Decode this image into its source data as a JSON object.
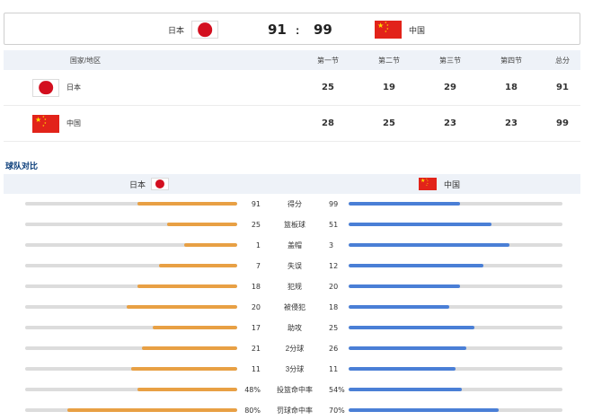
{
  "scoreboard": {
    "home": {
      "name": "日本",
      "score": "91"
    },
    "away": {
      "name": "中国",
      "score": "99"
    },
    "separator": ":"
  },
  "quarters": {
    "headers": [
      "国家/地区",
      "第一节",
      "第二节",
      "第三节",
      "第四节",
      "总分"
    ],
    "rows": [
      {
        "team": "日本",
        "flag": "japan-flag-icon",
        "q1": "25",
        "q2": "19",
        "q3": "29",
        "q4": "18",
        "total": "91"
      },
      {
        "team": "中国",
        "flag": "china-flag-icon",
        "q1": "28",
        "q2": "25",
        "q3": "23",
        "q4": "23",
        "total": "99"
      }
    ]
  },
  "comparison": {
    "title": "球队对比",
    "left_team": "日本",
    "right_team": "中国",
    "stats": [
      {
        "label": "得分",
        "left": "91",
        "right": "99",
        "left_pct": 0.47,
        "right_pct": 0.52
      },
      {
        "label": "篮板球",
        "left": "25",
        "right": "51",
        "left_pct": 0.33,
        "right_pct": 0.67
      },
      {
        "label": "盖帽",
        "left": "1",
        "right": "3",
        "left_pct": 0.25,
        "right_pct": 0.75
      },
      {
        "label": "失误",
        "left": "7",
        "right": "12",
        "left_pct": 0.37,
        "right_pct": 0.63
      },
      {
        "label": "犯规",
        "left": "18",
        "right": "20",
        "left_pct": 0.47,
        "right_pct": 0.52
      },
      {
        "label": "被侵犯",
        "left": "20",
        "right": "18",
        "left_pct": 0.52,
        "right_pct": 0.47
      },
      {
        "label": "助攻",
        "left": "17",
        "right": "25",
        "left_pct": 0.4,
        "right_pct": 0.59
      },
      {
        "label": "2分球",
        "left": "21",
        "right": "26",
        "left_pct": 0.45,
        "right_pct": 0.55
      },
      {
        "label": "3分球",
        "left": "11",
        "right": "11",
        "left_pct": 0.5,
        "right_pct": 0.5
      },
      {
        "label": "投篮命中率",
        "left": "48%",
        "right": "54%",
        "left_pct": 0.47,
        "right_pct": 0.53
      },
      {
        "label": "罚球命中率",
        "left": "80%",
        "right": "70%",
        "left_pct": 0.8,
        "right_pct": 0.7
      }
    ]
  },
  "colors": {
    "japan_bar": "#e8a044",
    "china_bar": "#4a7fd6",
    "track": "#dcdcdc",
    "header_bg": "#eef2f8",
    "title": "#0a3d7a",
    "japan_red": "#d30f1f",
    "china_red": "#e2231a",
    "china_star": "#ffde00"
  }
}
